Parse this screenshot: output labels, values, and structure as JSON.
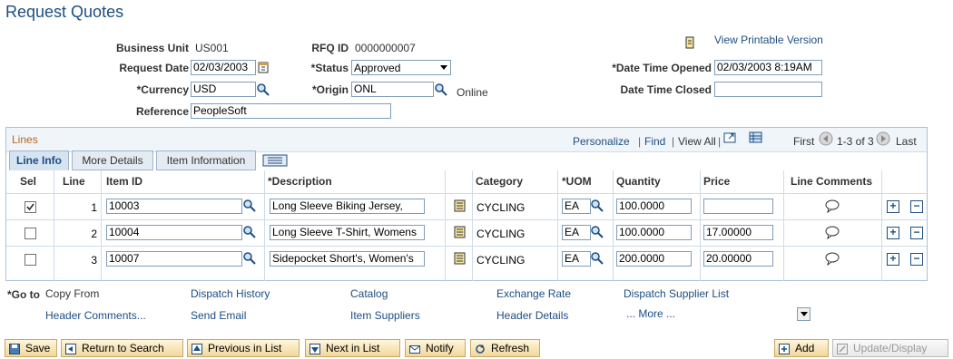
{
  "page": {
    "title": "Request Quotes"
  },
  "header": {
    "business_unit_label": "Business Unit",
    "business_unit": "US001",
    "rfq_id_label": "RFQ ID",
    "rfq_id": "0000000007",
    "view_printable": "View Printable Version",
    "request_date_label": "Request Date",
    "request_date": "02/03/2003",
    "status_label": "*Status",
    "status": "Approved",
    "date_time_opened_label": "*Date Time Opened",
    "date_time_opened": "02/03/2003  8:19AM",
    "currency_label": "*Currency",
    "currency": "USD",
    "origin_label": "*Origin",
    "origin": "ONL",
    "origin_desc": "Online",
    "date_time_closed_label": "Date Time Closed",
    "date_time_closed": "",
    "reference_label": "Reference",
    "reference": "PeopleSoft"
  },
  "lines": {
    "title": "Lines",
    "personalize": "Personalize",
    "find": "Find",
    "view_all": "View All",
    "first": "First",
    "range": "1-3 of 3",
    "last": "Last",
    "tabs": [
      "Line Info",
      "More Details",
      "Item Information"
    ],
    "columns": {
      "sel": "Sel",
      "line": "Line",
      "item_id": "Item ID",
      "description": "*Description",
      "category": "Category",
      "uom": "*UOM",
      "quantity": "Quantity",
      "price": "Price",
      "line_comments": "Line Comments"
    },
    "rows": [
      {
        "selected": true,
        "line": "1",
        "item_id": "10003",
        "description": "Long Sleeve Biking Jersey,",
        "category": "CYCLING",
        "uom": "EA",
        "quantity": "100.0000",
        "price": ""
      },
      {
        "selected": false,
        "line": "2",
        "item_id": "10004",
        "description": "Long Sleeve T-Shirt, Womens",
        "category": "CYCLING",
        "uom": "EA",
        "quantity": "100.0000",
        "price": "17.00000"
      },
      {
        "selected": false,
        "line": "3",
        "item_id": "10007",
        "description": "Sidepocket Short's, Women's",
        "category": "CYCLING",
        "uom": "EA",
        "quantity": "200.0000",
        "price": "20.00000"
      }
    ]
  },
  "goto": {
    "label": "*Go to",
    "copy_from": "Copy From",
    "links": [
      "Dispatch History",
      "Catalog",
      "Exchange Rate",
      "Dispatch Supplier List",
      "Header Comments...",
      "Send Email",
      "Item Suppliers",
      "Header Details",
      "... More ..."
    ]
  },
  "toolbar": {
    "save": "Save",
    "return_to_search": "Return to Search",
    "previous_in_list": "Previous in List",
    "next_in_list": "Next in List",
    "notify": "Notify",
    "refresh": "Refresh",
    "add": "Add",
    "update_display": "Update/Display"
  },
  "colors": {
    "title": "#1d4e82",
    "link": "#1d4e82",
    "grid_border": "#a9c1d9",
    "lines_title": "#b8641e"
  }
}
